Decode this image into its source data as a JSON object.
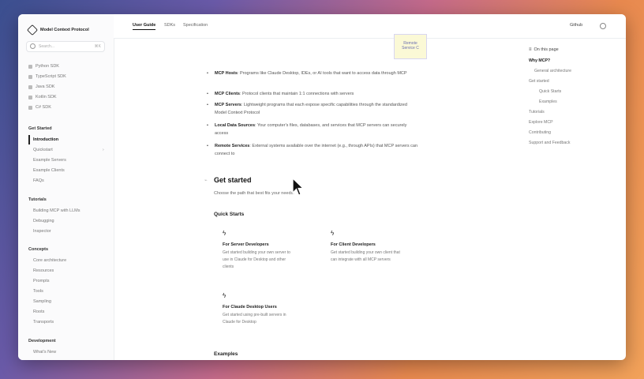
{
  "app": {
    "logo": "Model Context Protocol"
  },
  "search": {
    "placeholder": "Search...",
    "shortcut": "⌘K"
  },
  "sidebar": {
    "sdks": [
      "Python SDK",
      "TypeScript SDK",
      "Java SDK",
      "Kotlin SDK",
      "C# SDK"
    ],
    "groups": [
      {
        "title": "Get Started",
        "items": [
          "Introduction",
          "Quickstart",
          "Example Servers",
          "Example Clients",
          "FAQs"
        ],
        "active": "Introduction"
      },
      {
        "title": "Tutorials",
        "items": [
          "Building MCP with LLMs",
          "Debugging",
          "Inspector"
        ]
      },
      {
        "title": "Concepts",
        "items": [
          "Core architecture",
          "Resources",
          "Prompts",
          "Tools",
          "Sampling",
          "Roots",
          "Transports"
        ]
      },
      {
        "title": "Development",
        "items": [
          "What's New"
        ]
      }
    ]
  },
  "topbar": {
    "tabs": [
      "User Guide",
      "SDKs",
      "Specification"
    ],
    "active_tab": "User Guide",
    "github_label": "Github"
  },
  "diagram": {
    "label_line1": "Remote",
    "label_line2": "Service C"
  },
  "bullets": [
    {
      "term": "MCP Hosts",
      "text": ": Programs like Claude Desktop, IDEs, or AI tools that want to access data through MCP"
    },
    {
      "term": "MCP Clients",
      "text": ": Protocol clients that maintain 1:1 connections with servers"
    },
    {
      "term": "MCP Servers",
      "text": ": Lightweight programs that each expose specific capabilities through the standardized Model Context Protocol"
    },
    {
      "term": "Local Data Sources",
      "text": ": Your computer's files, databases, and services that MCP servers can securely access"
    },
    {
      "term": "Remote Services",
      "text": ": External systems available over the internet (e.g., through APIs) that MCP servers can connect to"
    }
  ],
  "get_started": {
    "title": "Get started",
    "desc": "Choose the path that best fits your needs:",
    "quick_starts_title": "Quick Starts",
    "cards": [
      {
        "title": "For Server Developers",
        "desc": "Get started building your own server to use in Claude for Desktop and other clients"
      },
      {
        "title": "For Client Developers",
        "desc": "Get started building your own client that can integrate with all MCP servers"
      },
      {
        "title": "For Claude Desktop Users",
        "desc": "Get started using pre-built servers in Claude for Desktop"
      }
    ],
    "examples_title": "Examples"
  },
  "toc": {
    "heading": "On this page",
    "items": [
      "Why MCP?",
      "General architecture",
      "Get started",
      "Quick Starts",
      "Examples",
      "Tutorials",
      "Explore MCP",
      "Contributing",
      "Support and Feedback"
    ]
  }
}
